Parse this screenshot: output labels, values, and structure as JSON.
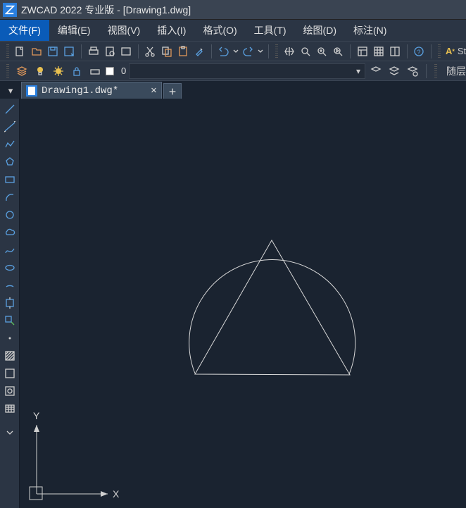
{
  "title": "ZWCAD 2022 专业版 - [Drawing1.dwg]",
  "menus": {
    "file": "文件(F)",
    "edit": "编辑(E)",
    "view": "视图(V)",
    "insert": "插入(I)",
    "format": "格式(O)",
    "tools": "工具(T)",
    "draw": "绘图(D)",
    "dimension": "标注(N)"
  },
  "layer": {
    "current": "0",
    "linetype": "随层"
  },
  "tab": {
    "name": "Drawing1.dwg*"
  },
  "text_style_btn": "St",
  "ucs": {
    "x": "X",
    "y": "Y"
  }
}
